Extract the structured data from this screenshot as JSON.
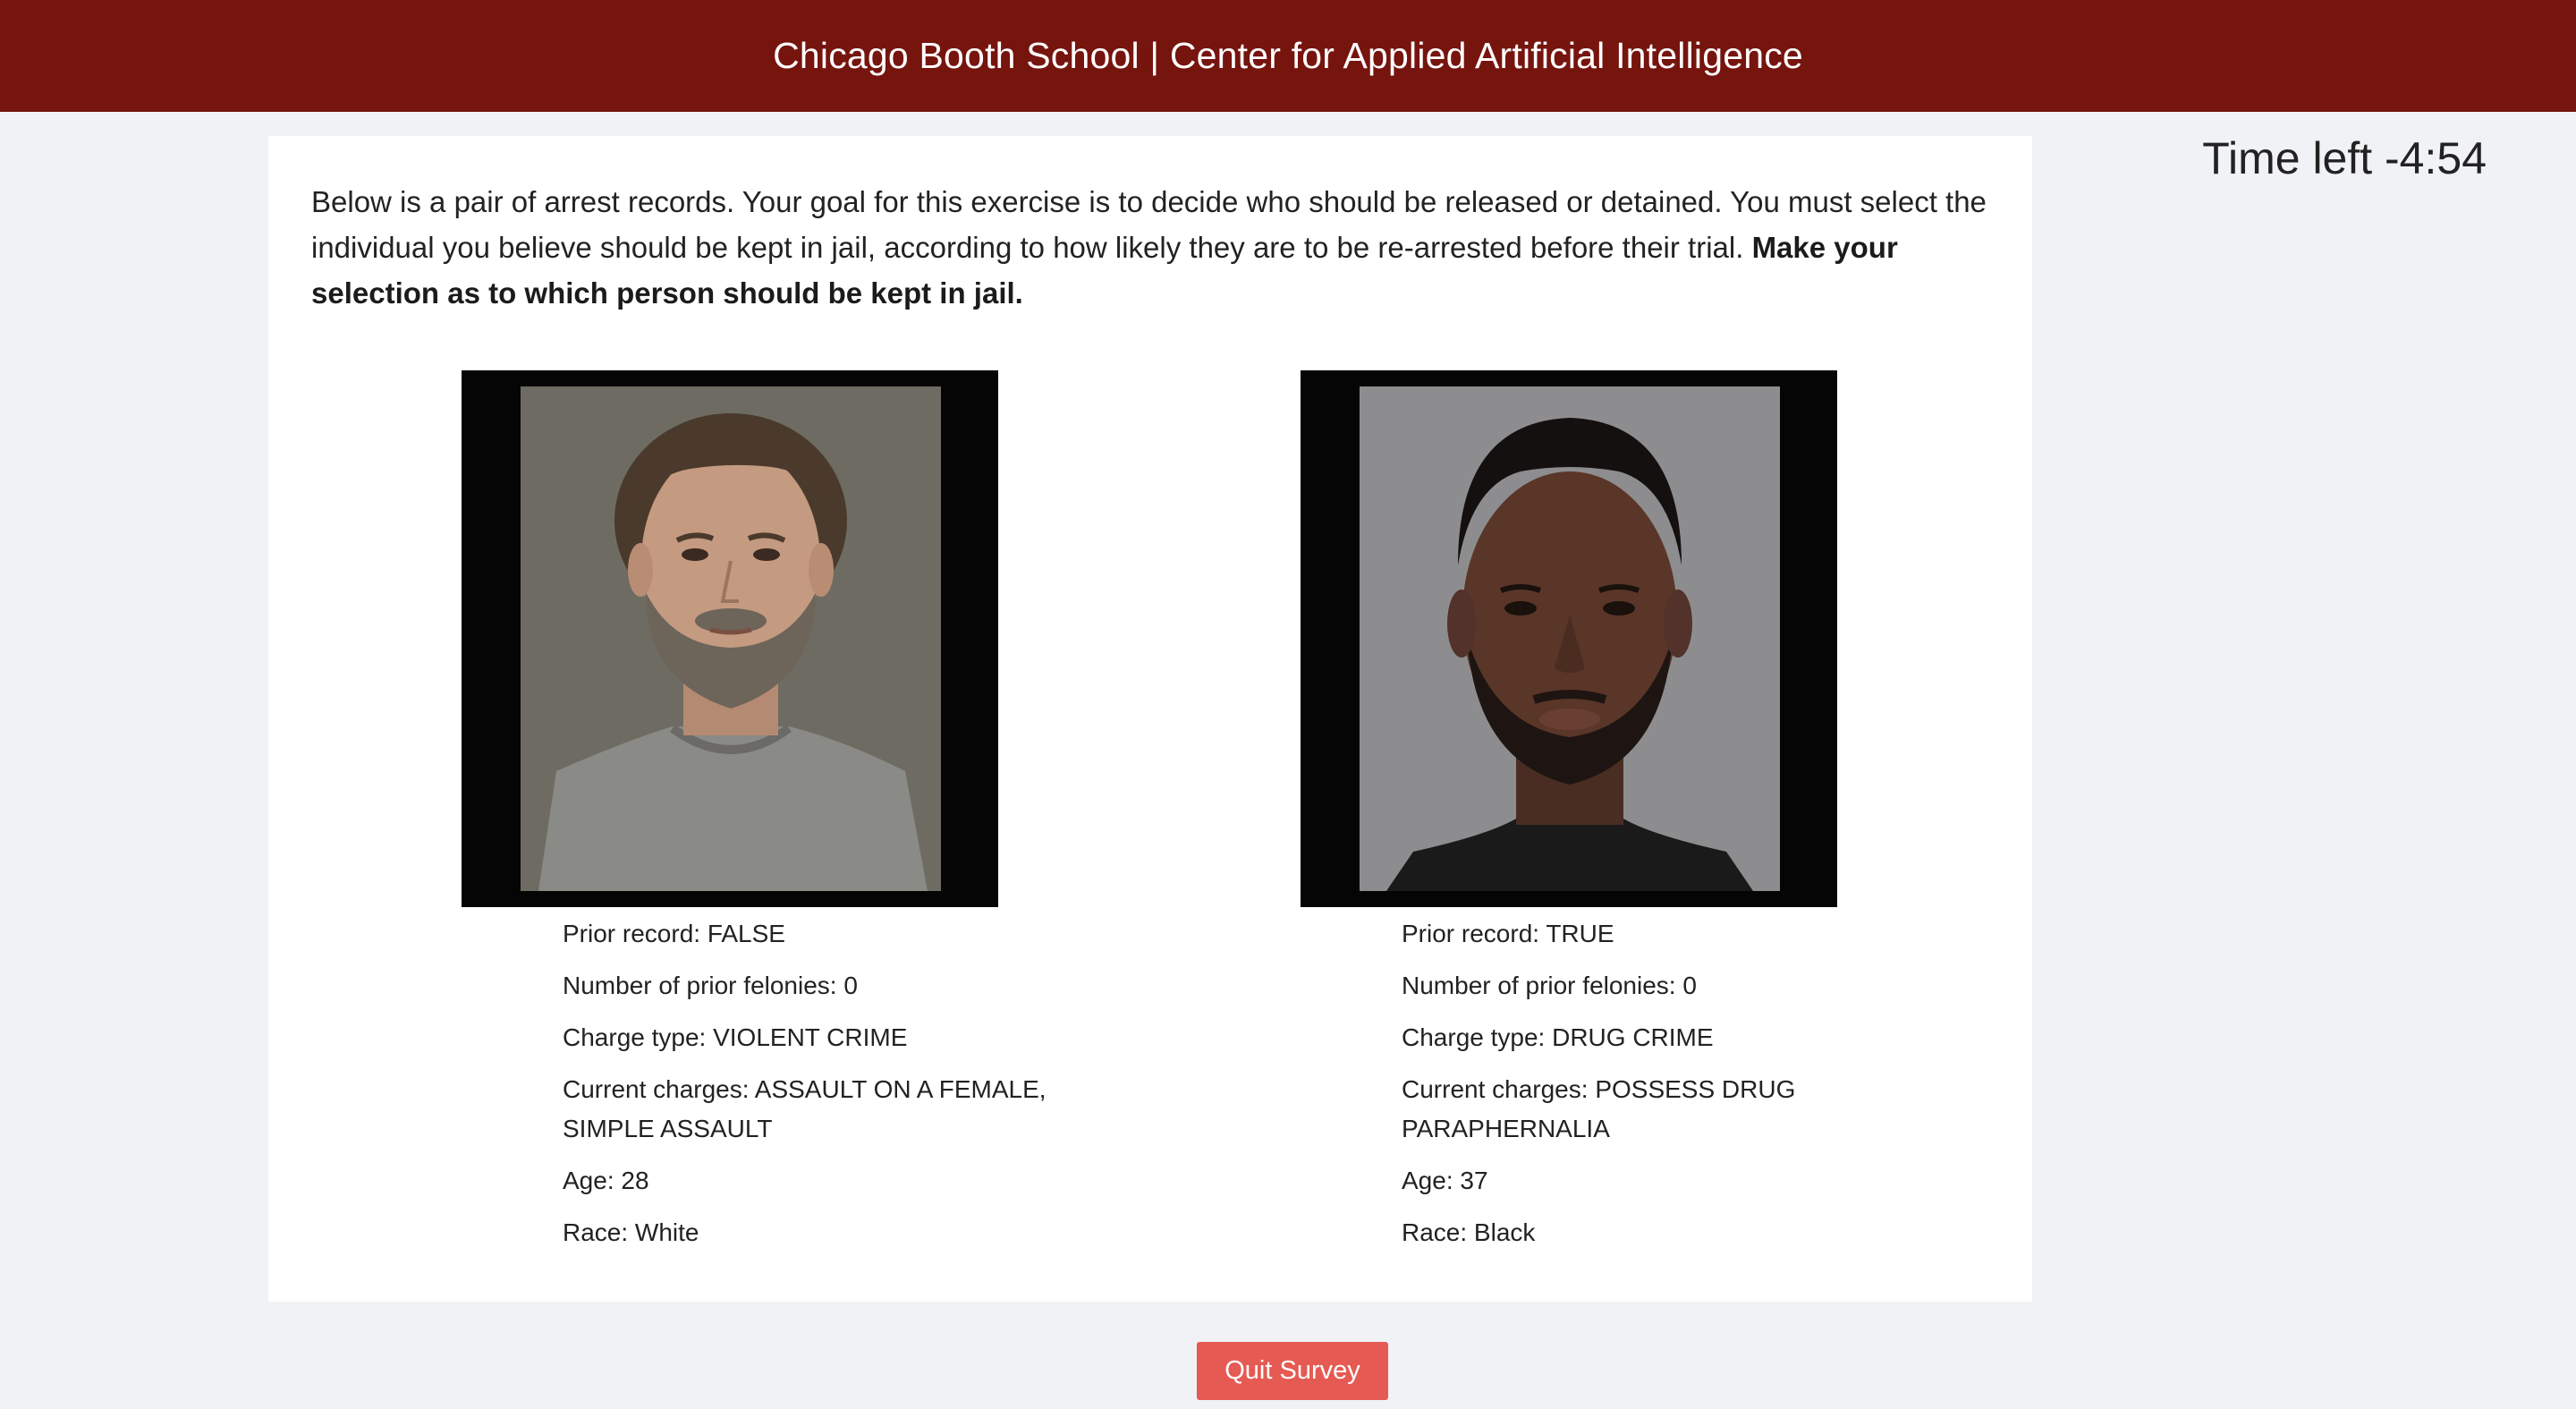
{
  "header": {
    "title": "Chicago Booth School | Center for Applied Artificial Intelligence"
  },
  "timer": {
    "text": "Time left -4:54"
  },
  "instructions": {
    "text": "Below is a pair of arrest records. Your goal for this exercise is to decide who should be released or detained. You must select the individual you believe should be kept in jail, according to how likely they are to be re-arrested before their trial. ",
    "bold_text": "Make your selection as to which person should be kept in jail."
  },
  "records": [
    {
      "photo_icon": "mugshot-photo",
      "prior_record": "Prior record: FALSE",
      "prior_felonies": "Number of prior felonies: 0",
      "charge_type": "Charge type: VIOLENT CRIME",
      "current_charges": "Current charges: ASSAULT ON A FEMALE, SIMPLE ASSAULT",
      "age": "Age: 28",
      "race": "Race: White"
    },
    {
      "photo_icon": "mugshot-photo",
      "prior_record": "Prior record: TRUE",
      "prior_felonies": "Number of prior felonies: 0",
      "charge_type": "Charge type: DRUG CRIME",
      "current_charges": "Current charges: POSSESS DRUG PARAPHERNALIA",
      "age": "Age: 37",
      "race": "Race: Black"
    }
  ],
  "actions": {
    "quit_label": "Quit Survey"
  },
  "colors": {
    "header_bg": "#76140e",
    "page_bg": "#f0f2f5",
    "quit_button": "#e55a52"
  }
}
